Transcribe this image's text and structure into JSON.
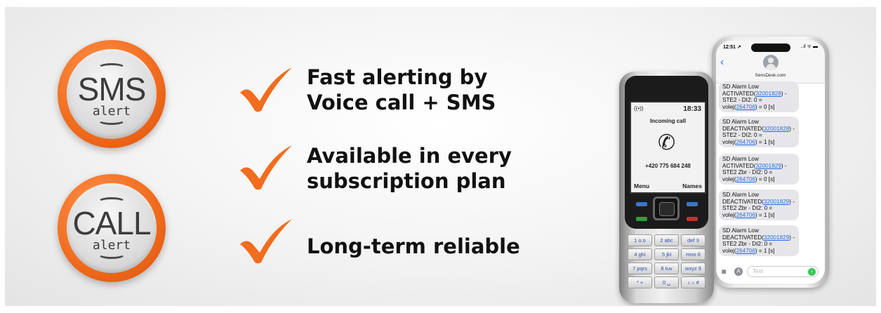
{
  "badges": [
    {
      "big": "SMS",
      "small": "alert"
    },
    {
      "big": "CALL",
      "small": "alert"
    }
  ],
  "features": [
    {
      "lines": [
        "Fast alerting by",
        "Voice call + SMS"
      ]
    },
    {
      "lines": [
        "Available in every",
        "subscription plan"
      ]
    },
    {
      "lines": [
        "Long-term reliable"
      ]
    }
  ],
  "colors": {
    "accent": "#f26d1f",
    "text": "#111111",
    "badge_gray": "#dcdcdc",
    "link": "#1f6fe0",
    "send": "#34c759"
  },
  "icons": [
    "checkmark-icon",
    "phone-handset-icon",
    "back-chevron-icon",
    "camera-icon",
    "app-store-icon",
    "send-arrow-icon",
    "contact-avatar-icon",
    "signal-icon"
  ],
  "nokia": {
    "signal": "((•))",
    "time": "18:33",
    "status": "Incoming call",
    "number": "+420 775 684 248",
    "left_soft": "Menu",
    "right_soft": "Names",
    "keys": [
      "1 o.o",
      "2 abc",
      "def 3",
      "4 ghi",
      "5 jkl",
      "mno 6",
      "7 pqrs",
      "8 tuv",
      "wxyz 9",
      "* +",
      "0 ␣",
      "♪ ⌂ #"
    ]
  },
  "iphone": {
    "time": "12:51 ↗",
    "status_icons": "..ıl ᯤ ▬",
    "contact": "SensDesk.com",
    "messages": [
      {
        "pre": "SD Alarm Low ACTIVATED(",
        "link1": "32001828",
        "mid": ") - STE2 - DI2: 0 = volej(",
        "link2": "264706",
        "post": ") = 0 [s]"
      },
      {
        "pre": "SD Alarm Low DEACTIVATED(",
        "link1": "32001828",
        "mid": ") - STE2 - DI2: 0 = volej(",
        "link2": "264706",
        "post": ") = 1 [s]"
      },
      {
        "pre": "SD Alarm Low ACTIVATED(",
        "link1": "32001829",
        "mid": ") - STE2 Zbr - DI2: 0 = volej(",
        "link2": "264706",
        "post": ") = 0 [s]"
      },
      {
        "pre": "SD Alarm Low DEACTIVATED(",
        "link1": "32001829",
        "mid": ") - STE2 Zbr - DI2: 0 = volej(",
        "link2": "264706",
        "post": ") = 1 [s]"
      },
      {
        "pre": "SD Alarm Low DEACTIVATED(",
        "link1": "32001829",
        "mid": ") - STE2 Zbr - DI2: 0 = volej(",
        "link2": "264706",
        "post": ") = 1 [s]"
      }
    ],
    "input_placeholder": "Text"
  }
}
